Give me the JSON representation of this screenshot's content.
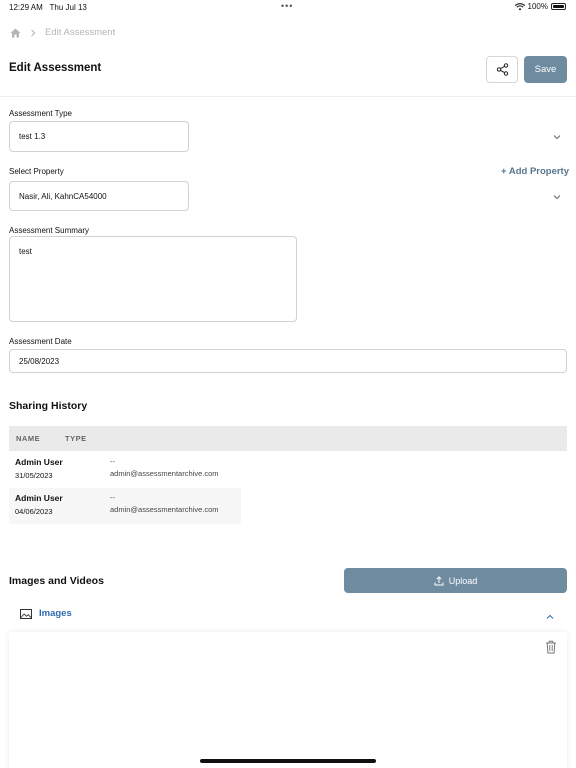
{
  "status_bar": {
    "time": "12:29 AM",
    "date": "Thu Jul 13",
    "dots": "•••",
    "battery": "100%"
  },
  "breadcrumb": {
    "home_icon": "home-icon",
    "separator_icon": "chevron-right-icon",
    "current": "Edit Assessment"
  },
  "header": {
    "title": "Edit Assessment",
    "share_icon": "share-icon",
    "save_label": "Save"
  },
  "form": {
    "assessment_type": {
      "label": "Assessment Type",
      "value": "test 1.3"
    },
    "property": {
      "label": "Select Property",
      "value": "Nasir, Ali, KahnCA54000",
      "add_label": "+ Add Property"
    },
    "summary": {
      "label": "Assessment Summary",
      "value": "test"
    },
    "date": {
      "label": "Assessment Date",
      "value": "25/08/2023"
    }
  },
  "sharing_history": {
    "title": "Sharing History",
    "columns": [
      "NAME",
      "TYPE"
    ],
    "rows": [
      {
        "name": "Admin User",
        "date": "31/05/2023",
        "type": "--",
        "email": "admin@assessmentarchive.com"
      },
      {
        "name": "Admin User",
        "date": "04/06/2023",
        "type": "--",
        "email": "admin@assessmentarchive.com"
      }
    ]
  },
  "media": {
    "title": "Images and Videos",
    "upload_label": "Upload",
    "images_tab": "Images",
    "delete_icon": "trash-icon"
  },
  "colors": {
    "accent": "#6f8ba0",
    "link": "#2d6bb0",
    "add_property": "#55768d"
  }
}
